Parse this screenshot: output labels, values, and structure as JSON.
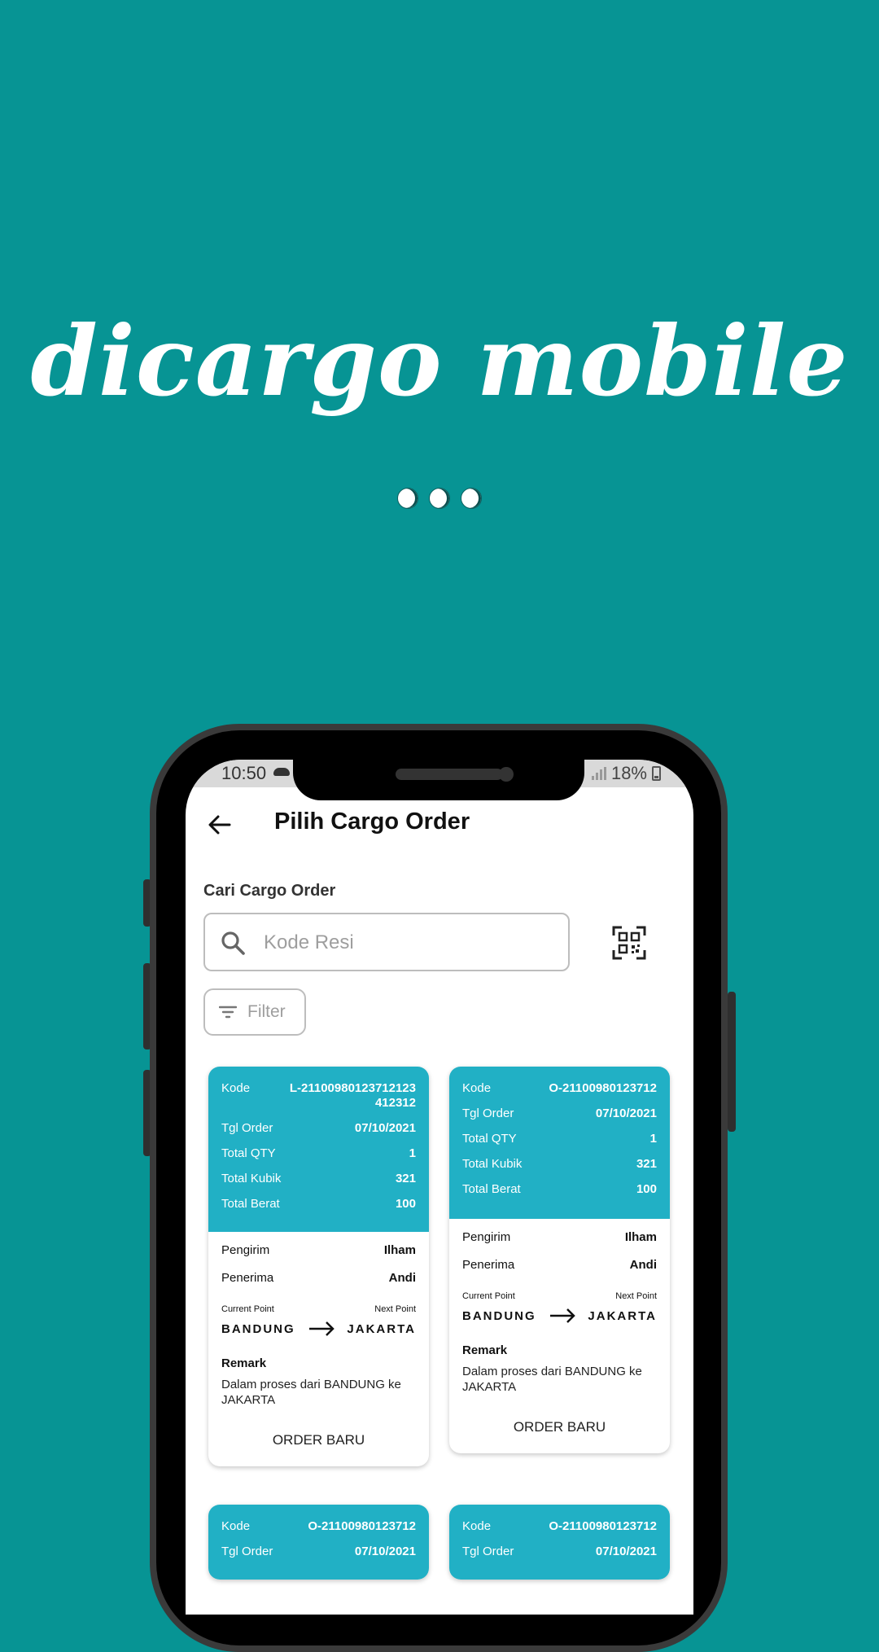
{
  "hero": {
    "title": "dicargo mobile"
  },
  "status_bar": {
    "time": "10:50",
    "battery": "18%"
  },
  "header": {
    "title": "Pilih Cargo Order"
  },
  "search": {
    "label": "Cari Cargo Order",
    "placeholder": "Kode Resi",
    "value": ""
  },
  "filter": {
    "label": "Filter"
  },
  "colors": {
    "background": "#079494",
    "card_header": "#21b0c5"
  },
  "labels": {
    "kode": "Kode",
    "tgl_order": "Tgl Order",
    "total_qty": "Total QTY",
    "total_kubik": "Total Kubik",
    "total_berat": "Total Berat",
    "pengirim": "Pengirim",
    "penerima": "Penerima",
    "current_point": "Current Point",
    "next_point": "Next Point",
    "remark": "Remark",
    "order_button": "ORDER BARU"
  },
  "orders": [
    {
      "kode": "L-21100980123712123412312",
      "tgl_order": "07/10/2021",
      "total_qty": "1",
      "total_kubik": "321",
      "total_berat": "100",
      "pengirim": "Ilham",
      "penerima": "Andi",
      "current_point": "BANDUNG",
      "next_point": "JAKARTA",
      "remark": "Dalam proses dari BANDUNG ke JAKARTA"
    },
    {
      "kode": "O-21100980123712",
      "tgl_order": "07/10/2021",
      "total_qty": "1",
      "total_kubik": "321",
      "total_berat": "100",
      "pengirim": "Ilham",
      "penerima": "Andi",
      "current_point": "BANDUNG",
      "next_point": "JAKARTA",
      "remark": "Dalam proses dari BANDUNG ke JAKARTA"
    },
    {
      "kode": "O-21100980123712",
      "tgl_order": "07/10/2021"
    },
    {
      "kode": "O-21100980123712",
      "tgl_order": "07/10/2021"
    }
  ]
}
